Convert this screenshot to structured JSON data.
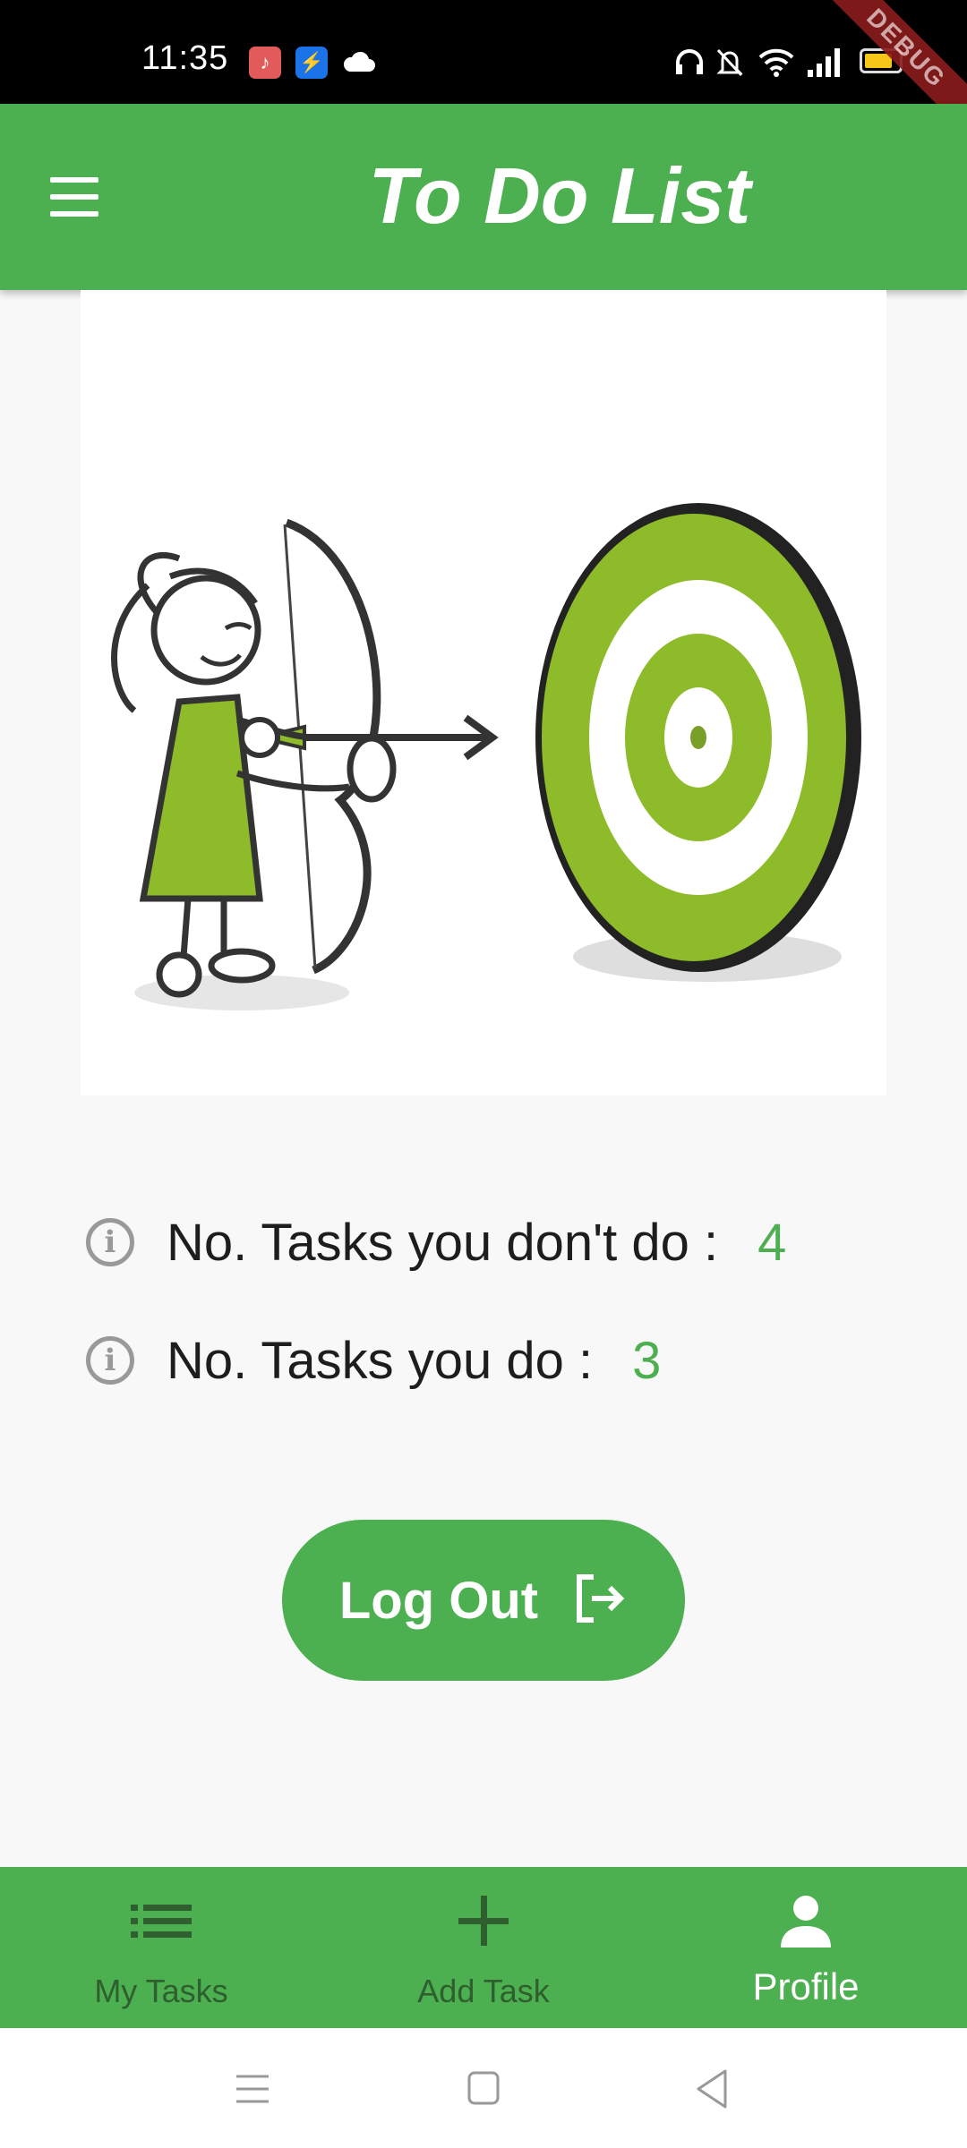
{
  "status_bar": {
    "time": "11:35",
    "debug_label": "DEBUG",
    "icons": [
      "music-app-icon",
      "usb-icon",
      "cloud-icon",
      "headphones-icon",
      "bell-muted-icon",
      "wifi-icon",
      "signal-icon",
      "battery-icon"
    ]
  },
  "app_bar": {
    "title": "To Do List"
  },
  "colors": {
    "primary": "#4caf50",
    "inactive_nav": "#2f5e2f",
    "info_icon": "#999999"
  },
  "stats": {
    "not_done_label": "No. Tasks you don't do :",
    "not_done_value": "4",
    "done_label": "No. Tasks you do :",
    "done_value": "3"
  },
  "logout": {
    "label": "Log Out"
  },
  "bottom_nav": {
    "items": [
      {
        "label": "My Tasks",
        "icon": "list-icon",
        "active": false
      },
      {
        "label": "Add Task",
        "icon": "plus-icon",
        "active": false
      },
      {
        "label": "Profile",
        "icon": "person-icon",
        "active": true
      }
    ]
  }
}
